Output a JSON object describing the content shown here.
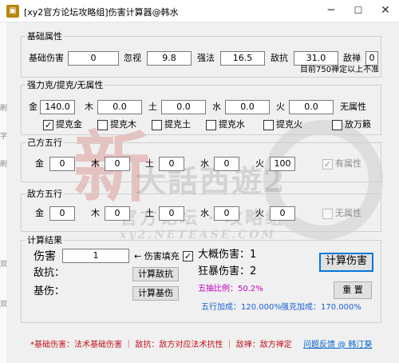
{
  "window": {
    "title": "[xy2官方论坛攻略组]伤害计算器@韩水",
    "min_glyph": "─",
    "max_glyph": "☐",
    "close_glyph": "✕"
  },
  "side_strip": {
    "chars": [
      "刷",
      "字",
      "刷",
      "双",
      "双"
    ]
  },
  "basic": {
    "group_label": "基础属性",
    "base_damage_label": "基础伤害",
    "base_damage": "0",
    "ignore_label": "忽视",
    "ignore": "9.8",
    "strengthen_label": "强法",
    "strengthen": "16.5",
    "resist_label": "敌抗",
    "resist": "31.0",
    "enemy_ban_label": "敌禅",
    "enemy_ban": "0",
    "note": "目前750禅定以上不准"
  },
  "strong": {
    "group_label": "强力克/提克/无属性",
    "elements": [
      {
        "label": "金",
        "value": "140.0"
      },
      {
        "label": "木",
        "value": "0.0"
      },
      {
        "label": "土",
        "value": "0.0"
      },
      {
        "label": "水",
        "value": "0.0"
      },
      {
        "label": "火",
        "value": "0.0"
      },
      {
        "label": "无属性",
        "value": "0.0"
      }
    ],
    "checks": [
      {
        "label": "提克金",
        "checked": true,
        "mark": "✓"
      },
      {
        "label": "提克木",
        "checked": false,
        "mark": ""
      },
      {
        "label": "提克土",
        "checked": false,
        "mark": ""
      },
      {
        "label": "提克水",
        "checked": false,
        "mark": ""
      },
      {
        "label": "提克火",
        "checked": false,
        "mark": ""
      },
      {
        "label": "放万籁",
        "checked": false,
        "mark": ""
      }
    ]
  },
  "self_five": {
    "group_label": "己方五行",
    "elements": [
      {
        "label": "金",
        "value": "0"
      },
      {
        "label": "木",
        "value": "0"
      },
      {
        "label": "土",
        "value": "0"
      },
      {
        "label": "水",
        "value": "0"
      },
      {
        "label": "火",
        "value": "100"
      }
    ],
    "attr_label": "有属性",
    "attr_mark": "✓"
  },
  "enemy_five": {
    "group_label": "敌方五行",
    "elements": [
      {
        "label": "金",
        "value": "0"
      },
      {
        "label": "木",
        "value": "0"
      },
      {
        "label": "土",
        "value": "0"
      },
      {
        "label": "水",
        "value": "0"
      },
      {
        "label": "火",
        "value": "0"
      }
    ],
    "attr_label": "无属性",
    "attr_mark": ""
  },
  "result": {
    "group_label": "计算结果",
    "damage_label": "伤害",
    "damage_value": "1",
    "fill_hint": "← 伤害填充",
    "fill_mark": "✓",
    "approx_label": "大概伤害：1",
    "resist_label": "敌抗：",
    "calc_resist_button": "计算敌抗",
    "crit_label": "狂暴伤害：2",
    "calc_button": "计算伤害",
    "base_label": "基伤：",
    "calc_base_button": "计算基伤",
    "five_ratio": "五抽比例：50.2%",
    "reset_button": "重 置",
    "five_bonus": "五行加成：120.000%",
    "strong_bonus": "强克加成：170.000%"
  },
  "footer": {
    "legend": "*基础伤害：法术基础伤害 ｜ 敌抗：敌方对应法术抗性 ｜ 敌禅：敌方禅定",
    "feedback_link": "问题反馈 @ 韩汀葵"
  },
  "watermark": {
    "big_char": "新",
    "slogan": "大話西遊2",
    "forum": "官方论坛 · 攻略组",
    "domain": "xy2.NETEASE.COM"
  },
  "colors": {
    "magenta": "#c000c0",
    "blue": "#1a5fd6",
    "red": "#c0101a",
    "link": "#0066cc"
  }
}
